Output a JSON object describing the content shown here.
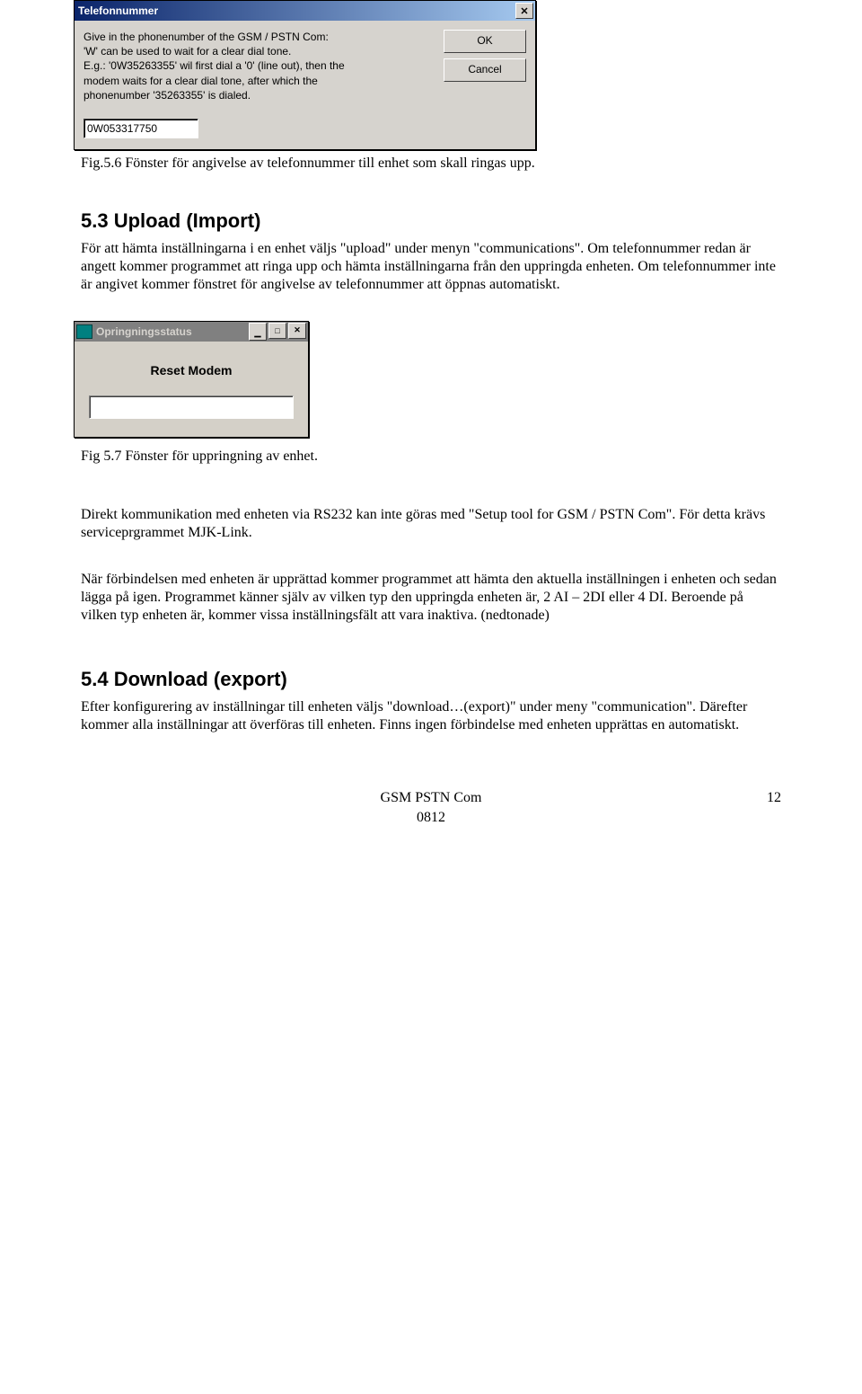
{
  "dialog1": {
    "title": "Telefonnummer",
    "instruct_line1": "Give in the phonenumber of the GSM / PSTN Com:",
    "instruct_line2": "'W' can be used to wait for a clear dial tone.",
    "instruct_line3": "E.g.: '0W35263355' wil first dial a '0' (line out), then the",
    "instruct_line4": "modem waits for a clear dial tone, after which the",
    "instruct_line5": "phonenumber '35263355' is dialed.",
    "input_value": "0W053317750",
    "ok_label": "OK",
    "cancel_label": "Cancel",
    "close_label": "✕"
  },
  "caption1": "Fig.5.6 Fönster för angivelse av telefonnummer till enhet som skall ringas upp.",
  "section_upload_heading": "5.3   Upload (Import)",
  "upload_para": "För att hämta inställningarna i en enhet väljs \"upload\" under menyn \"communications\". Om telefonnummer redan är angett kommer programmet att ringa upp och hämta inställningarna från den uppringda enheten. Om telefonnummer inte är angivet kommer fönstret för angivelse av telefonnummer att öppnas automatiskt.",
  "dialog2": {
    "title": "Opringningsstatus",
    "status_label": "Reset Modem",
    "min_label": "▁",
    "max_label": "□",
    "close_label": "✕"
  },
  "caption2": "Fig 5.7 Fönster för uppringning av enhet.",
  "direkt_para": "Direkt kommunikation med enheten via RS232 kan inte göras med \"Setup tool for GSM / PSTN Com\". För detta krävs serviceprgrammet MJK-Link.",
  "forbind_para": "När förbindelsen med enheten är upprättad kommer programmet att hämta den aktuella inställningen i enheten och sedan lägga på igen. Programmet känner själv av vilken typ den uppringda enheten är, 2 AI – 2DI eller 4 DI. Beroende på vilken typ enheten är, kommer vissa inställningsfält att vara inaktiva. (nedtonade)",
  "section_download_heading": "5.4   Download (export)",
  "download_para": "Efter konfigurering av inställningar till enheten väljs \"download…(export)\" under meny \"communication\". Därefter kommer alla inställningar att överföras till enheten. Finns ingen förbindelse med enheten upprättas en automatiskt.",
  "footer": {
    "doc_title": "GSM PSTN Com",
    "doc_code": "0812",
    "page_number": "12"
  }
}
